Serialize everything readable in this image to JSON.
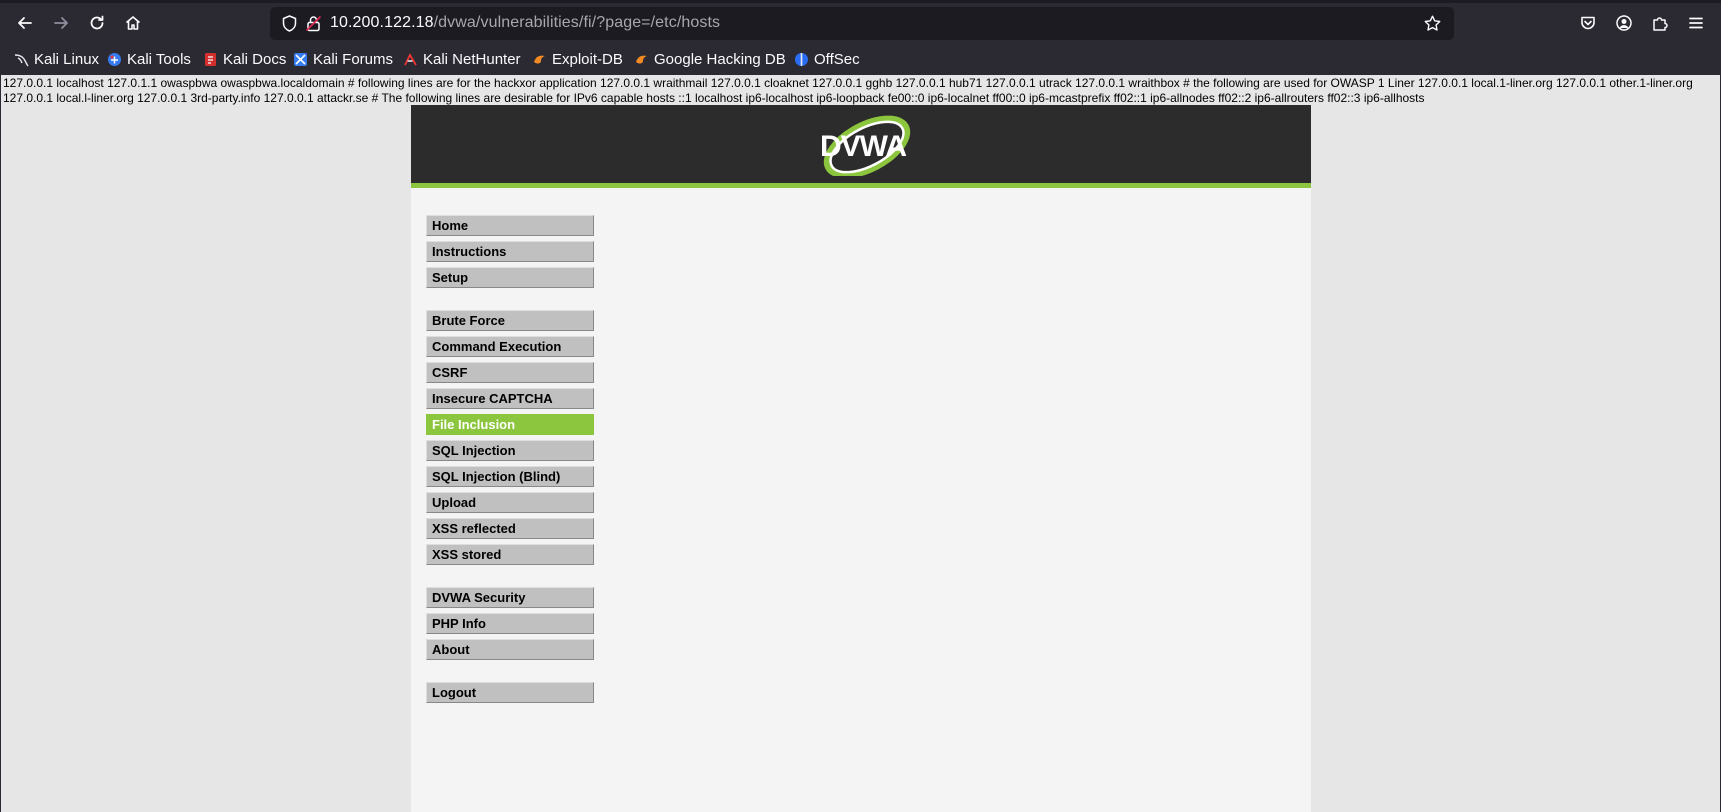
{
  "browser": {
    "url_host": "10.200.122.18",
    "url_path": "/dvwa/vulnerabilities/fi/?page=/etc/hosts",
    "bookmarks": [
      {
        "label": "Kali Linux",
        "icon": "kali-dragon-icon"
      },
      {
        "label": "Kali Tools",
        "icon": "kali-tools-icon"
      },
      {
        "label": "Kali Docs",
        "icon": "kali-docs-icon"
      },
      {
        "label": "Kali Forums",
        "icon": "kali-forums-icon"
      },
      {
        "label": "Kali NetHunter",
        "icon": "kali-nethunter-icon"
      },
      {
        "label": "Exploit-DB",
        "icon": "exploit-db-icon"
      },
      {
        "label": "Google Hacking DB",
        "icon": "ghdb-icon"
      },
      {
        "label": "OffSec",
        "icon": "offsec-icon"
      }
    ]
  },
  "page": {
    "hosts_output": "127.0.0.1 localhost 127.0.1.1 owaspbwa owaspbwa.localdomain # following lines are for the hackxor application 127.0.0.1 wraithmail 127.0.0.1 cloaknet 127.0.0.1 gghb 127.0.0.1 hub71 127.0.0.1 utrack 127.0.0.1 wraithbox # the following are used for OWASP 1 Liner 127.0.0.1 local.1-liner.org 127.0.0.1 other.1-liner.org 127.0.0.1 local.l-liner.org 127.0.0.1 3rd-party.info 127.0.0.1 attackr.se # The following lines are desirable for IPv6 capable hosts ::1 localhost ip6-localhost ip6-loopback fe00::0 ip6-localnet ff00::0 ip6-mcastprefix ff02::1 ip6-allnodes ff02::2 ip6-allrouters ff02::3 ip6-allhosts",
    "logo_text": "DVWA",
    "accent_color": "#8cc63e"
  },
  "menu": {
    "group1": [
      "Home",
      "Instructions",
      "Setup"
    ],
    "group2": [
      "Brute Force",
      "Command Execution",
      "CSRF",
      "Insecure CAPTCHA",
      "File Inclusion",
      "SQL Injection",
      "SQL Injection (Blind)",
      "Upload",
      "XSS reflected",
      "XSS stored"
    ],
    "group3": [
      "DVWA Security",
      "PHP Info",
      "About"
    ],
    "group4": [
      "Logout"
    ],
    "selected": "File Inclusion"
  }
}
